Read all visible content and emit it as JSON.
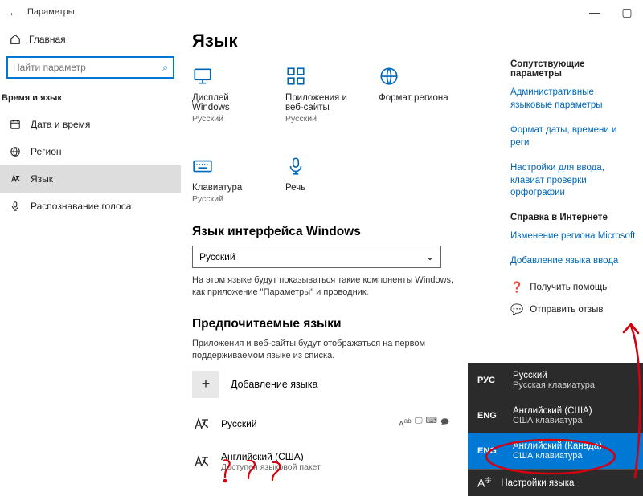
{
  "titlebar": {
    "label": "Параметры"
  },
  "sidebar": {
    "home": "Главная",
    "search_placeholder": "Найти параметр",
    "category": "Время и язык",
    "items": [
      {
        "label": "Дата и время"
      },
      {
        "label": "Регион"
      },
      {
        "label": "Язык"
      },
      {
        "label": "Распознавание голоса"
      }
    ]
  },
  "main": {
    "title": "Язык",
    "cards": [
      {
        "title": "Дисплей Windows",
        "sub": "Русский"
      },
      {
        "title": "Приложения и веб-сайты",
        "sub": "Русский"
      },
      {
        "title": "Формат региона",
        "sub": ""
      },
      {
        "title": "Клавиатура",
        "sub": "Русский"
      },
      {
        "title": "Речь",
        "sub": ""
      }
    ],
    "uilang_heading": "Язык интерфейса Windows",
    "uilang_value": "Русский",
    "uilang_desc": "На этом языке будут показываться такие компоненты Windows, как приложение \"Параметры\" и проводник.",
    "preferred_heading": "Предпочитаемые языки",
    "preferred_desc": "Приложения и веб-сайты будут отображаться на первом поддерживаемом языке из списка.",
    "add_language": "Добавление языка",
    "langs": [
      {
        "title": "Русский",
        "sub": ""
      },
      {
        "title": "Английский (США)",
        "sub": "Доступен языковой пакет"
      }
    ]
  },
  "right": {
    "related_heading": "Сопутствующие параметры",
    "links": [
      "Административные языковые параметры",
      "Формат даты, времени и реги",
      "Настройки для ввода, клавиат проверки орфографии"
    ],
    "help_heading": "Справка в Интернете",
    "help_links": [
      "Изменение региона Microsoft",
      "Добавление языка ввода"
    ],
    "get_help": "Получить помощь",
    "feedback": "Отправить отзыв"
  },
  "popup": {
    "items": [
      {
        "code": "РУС",
        "title": "Русский",
        "sub": "Русская клавиатура",
        "selected": false
      },
      {
        "code": "ENG",
        "title": "Английский (США)",
        "sub": "США клавиатура",
        "selected": false
      },
      {
        "code": "ENG",
        "title": "Английский (Канада)",
        "sub": "США клавиатура",
        "selected": true
      }
    ],
    "settings": "Настройки языка"
  }
}
